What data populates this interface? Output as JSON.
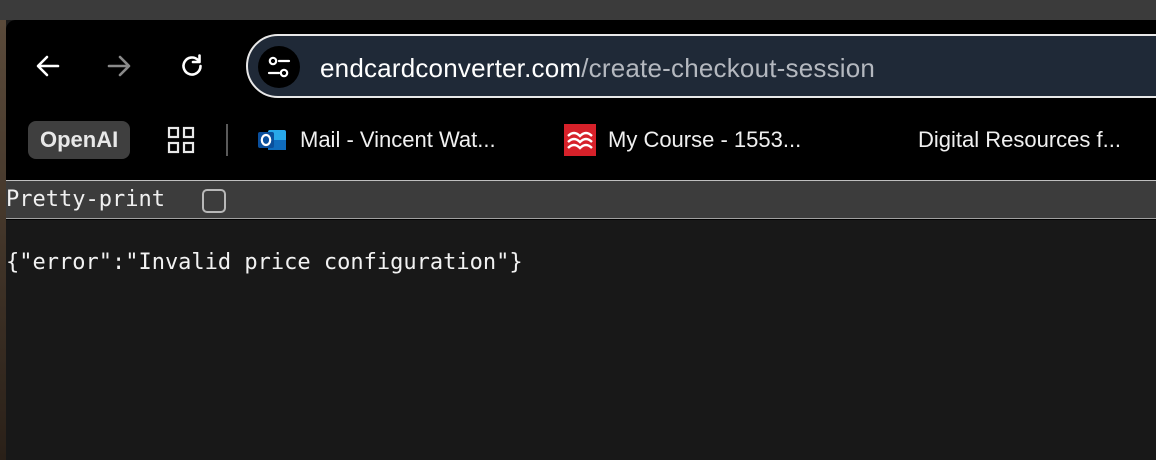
{
  "browser": {
    "url_host": "endcardconverter.com",
    "url_path": "/create-checkout-session",
    "nav": {
      "back_icon": "arrow-left-icon",
      "forward_icon": "arrow-right-icon",
      "reload_icon": "reload-icon",
      "site_info_icon": "tune-icon"
    }
  },
  "bookmarks": [
    {
      "label": "OpenAI"
    },
    {
      "icon": "apps-grid-icon"
    },
    {
      "label": "Mail - Vincent Wat...",
      "icon": "outlook-icon",
      "color": "#0f6cbd"
    },
    {
      "label": "My Course - 1553...",
      "icon": "mcgraw-hill-icon",
      "color": "#d6212a"
    },
    {
      "label": "Digital Resources f..."
    }
  ],
  "viewer": {
    "pretty_print_label": "Pretty-print",
    "pretty_print_checked": false,
    "body": "{\"error\":\"Invalid price configuration\"}"
  }
}
